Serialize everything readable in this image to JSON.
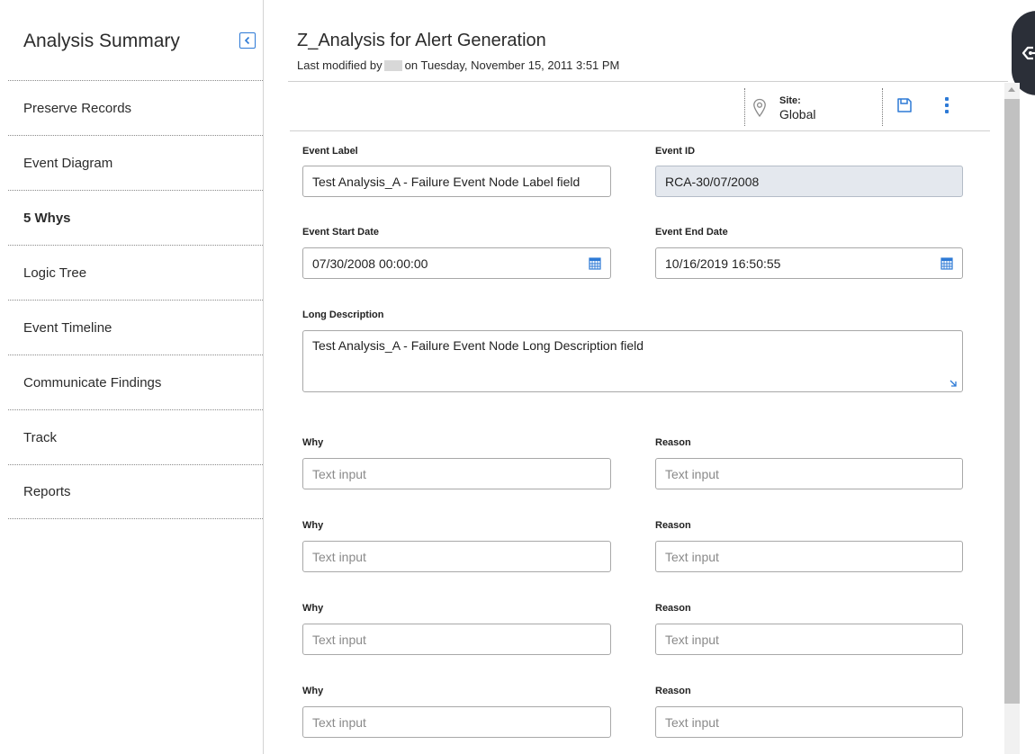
{
  "sidebar": {
    "title": "Analysis Summary",
    "items": [
      {
        "label": "Preserve Records"
      },
      {
        "label": "Event Diagram"
      },
      {
        "label": "5 Whys",
        "active": true
      },
      {
        "label": "Logic Tree"
      },
      {
        "label": "Event Timeline"
      },
      {
        "label": "Communicate Findings"
      },
      {
        "label": "Track"
      },
      {
        "label": "Reports"
      }
    ]
  },
  "header": {
    "title": "Z_Analysis for Alert Generation",
    "modified_prefix": "Last modified by",
    "modified_suffix": "on Tuesday, November 15, 2011 3:51 PM"
  },
  "toolbar": {
    "site_label": "Site:",
    "site_value": "Global"
  },
  "form": {
    "event_label": {
      "label": "Event Label",
      "value": "Test Analysis_A  - Failure Event Node Label field"
    },
    "event_id": {
      "label": "Event ID",
      "value": "RCA-30/07/2008"
    },
    "event_start": {
      "label": "Event Start Date",
      "value": "07/30/2008 00:00:00"
    },
    "event_end": {
      "label": "Event End Date",
      "value": "10/16/2019 16:50:55"
    },
    "long_description": {
      "label": "Long Description",
      "value": "Test Analysis_A  - Failure Event Node Long Description field"
    },
    "whys": [
      {
        "why_label": "Why",
        "why_placeholder": "Text input",
        "reason_label": "Reason",
        "reason_placeholder": "Text input"
      },
      {
        "why_label": "Why",
        "why_placeholder": "Text input",
        "reason_label": "Reason",
        "reason_placeholder": "Text input"
      },
      {
        "why_label": "Why",
        "why_placeholder": "Text input",
        "reason_label": "Reason",
        "reason_placeholder": "Text input"
      },
      {
        "why_label": "Why",
        "why_placeholder": "Text input",
        "reason_label": "Reason",
        "reason_placeholder": "Text input"
      }
    ]
  },
  "colors": {
    "accent": "#2d7ad6",
    "panel_button": "#2b2f38",
    "readonly_bg": "#e4e8ee"
  },
  "icons": [
    "collapse-left-icon",
    "panel-toggle-icon",
    "location-pin-icon",
    "save-icon",
    "more-vertical-icon",
    "calendar-icon",
    "resize-icon"
  ]
}
